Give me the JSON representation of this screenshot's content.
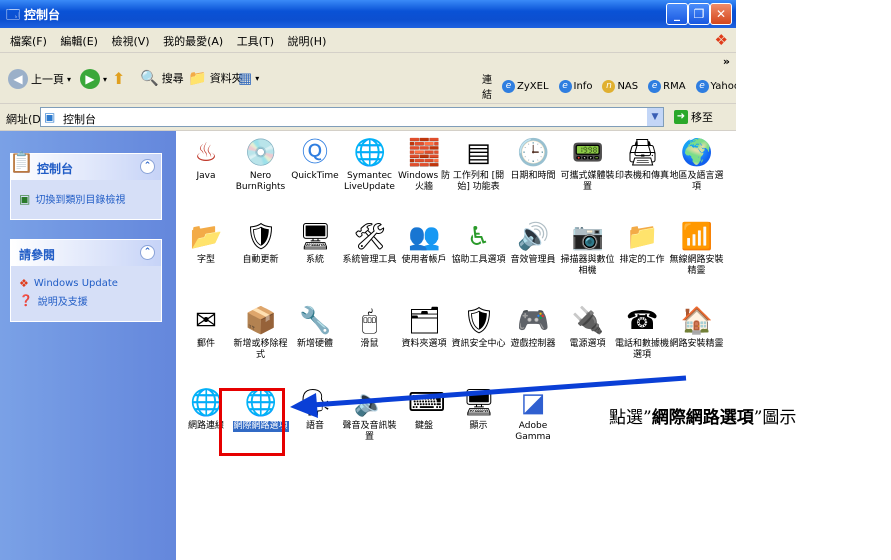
{
  "window": {
    "title": "控制台"
  },
  "menu": [
    "檔案(F)",
    "編輯(E)",
    "檢視(V)",
    "我的最愛(A)",
    "工具(T)",
    "說明(H)"
  ],
  "toolbar": {
    "back": "上一頁",
    "search": "搜尋",
    "folders": "資料夾"
  },
  "links": {
    "label": "連結",
    "items": [
      "ZyXEL",
      "Info",
      "NAS",
      "RMA",
      "Yahoo!"
    ],
    "more": "»"
  },
  "address": {
    "label": "網址(D)",
    "value": "控制台",
    "go": "移至"
  },
  "leftpane": {
    "panel1": {
      "title": "控制台",
      "items": [
        "切換到類別目錄檢視"
      ]
    },
    "panel2": {
      "title": "請參閱",
      "items": [
        "Windows Update",
        "說明及支援"
      ]
    }
  },
  "items": [
    {
      "label": "Java",
      "icon": "java-icon"
    },
    {
      "label": "Nero BurnRights",
      "icon": "nero-icon"
    },
    {
      "label": "QuickTime",
      "icon": "quicktime-icon"
    },
    {
      "label": "Symantec LiveUpdate",
      "icon": "liveupdate-icon"
    },
    {
      "label": "Windows 防火牆",
      "icon": "firewall-icon"
    },
    {
      "label": "工作列和 [開始] 功能表",
      "icon": "taskbar-icon"
    },
    {
      "label": "日期和時間",
      "icon": "clock-icon"
    },
    {
      "label": "可攜式媒體裝置",
      "icon": "media-device-icon"
    },
    {
      "label": "印表機和傳真",
      "icon": "printer-icon"
    },
    {
      "label": "地區及語言選項",
      "icon": "globe-icon"
    },
    {
      "label": "字型",
      "icon": "font-folder-icon"
    },
    {
      "label": "自動更新",
      "icon": "auto-update-icon"
    },
    {
      "label": "系統",
      "icon": "system-icon"
    },
    {
      "label": "系統管理工具",
      "icon": "admin-tools-icon"
    },
    {
      "label": "使用者帳戶",
      "icon": "users-icon"
    },
    {
      "label": "協助工具選項",
      "icon": "accessibility-icon"
    },
    {
      "label": "音效管理員",
      "icon": "sound-manager-icon"
    },
    {
      "label": "掃描器與數位相機",
      "icon": "scanner-icon"
    },
    {
      "label": "排定的工作",
      "icon": "scheduled-tasks-icon"
    },
    {
      "label": "無線網路安裝精靈",
      "icon": "wireless-icon"
    },
    {
      "label": "郵件",
      "icon": "mail-icon"
    },
    {
      "label": "新增或移除程式",
      "icon": "add-remove-icon"
    },
    {
      "label": "新增硬體",
      "icon": "add-hardware-icon"
    },
    {
      "label": "滑鼠",
      "icon": "mouse-icon"
    },
    {
      "label": "資料夾選項",
      "icon": "folder-options-icon"
    },
    {
      "label": "資訊安全中心",
      "icon": "security-center-icon"
    },
    {
      "label": "遊戲控制器",
      "icon": "game-controller-icon"
    },
    {
      "label": "電源選項",
      "icon": "power-icon"
    },
    {
      "label": "電話和數據機選項",
      "icon": "phone-icon"
    },
    {
      "label": "網路安裝精靈",
      "icon": "network-setup-icon"
    },
    {
      "label": "網路連線",
      "icon": "network-connections-icon"
    },
    {
      "label": "網際網路選項",
      "icon": "internet-options-icon"
    },
    {
      "label": "語音",
      "icon": "speech-icon"
    },
    {
      "label": "聲音及音訊裝置",
      "icon": "audio-icon"
    },
    {
      "label": "鍵盤",
      "icon": "keyboard-icon"
    },
    {
      "label": "顯示",
      "icon": "display-icon"
    },
    {
      "label": "Adobe Gamma",
      "icon": "adobe-gamma-icon"
    }
  ],
  "annotation": {
    "prefix": "點選”",
    "bold": "網際網路選項",
    "suffix": "”圖示"
  },
  "colors": {
    "highlight": "#e60000",
    "arrow": "#0a3fd6",
    "titlebar": "#0a52d6"
  }
}
